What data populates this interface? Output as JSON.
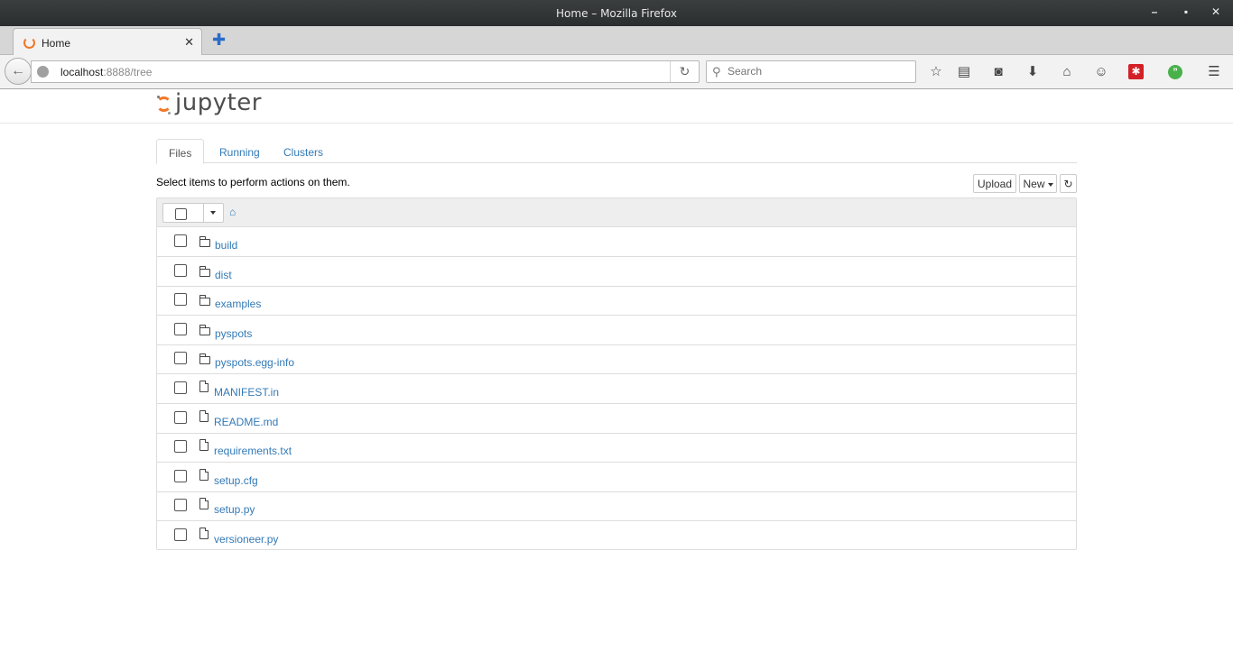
{
  "window": {
    "title": "Home – Mozilla Firefox"
  },
  "browser": {
    "tab_title": "Home",
    "url_host": "localhost",
    "url_rest": ":8888/tree",
    "search_placeholder": "Search"
  },
  "jupyter": {
    "logo_text": "jupyter",
    "tabs": [
      "Files",
      "Running",
      "Clusters"
    ],
    "hint": "Select items to perform actions on them.",
    "upload_label": "Upload",
    "new_label": "New",
    "items": [
      {
        "name": "build",
        "kind": "folder"
      },
      {
        "name": "dist",
        "kind": "folder"
      },
      {
        "name": "examples",
        "kind": "folder"
      },
      {
        "name": "pyspots",
        "kind": "folder"
      },
      {
        "name": "pyspots.egg-info",
        "kind": "folder"
      },
      {
        "name": "MANIFEST.in",
        "kind": "file"
      },
      {
        "name": "README.md",
        "kind": "file"
      },
      {
        "name": "requirements.txt",
        "kind": "file"
      },
      {
        "name": "setup.cfg",
        "kind": "file"
      },
      {
        "name": "setup.py",
        "kind": "file"
      },
      {
        "name": "versioneer.py",
        "kind": "file"
      }
    ]
  },
  "colors": {
    "jupyter_orange": "#f37726",
    "link": "#337ab7"
  }
}
